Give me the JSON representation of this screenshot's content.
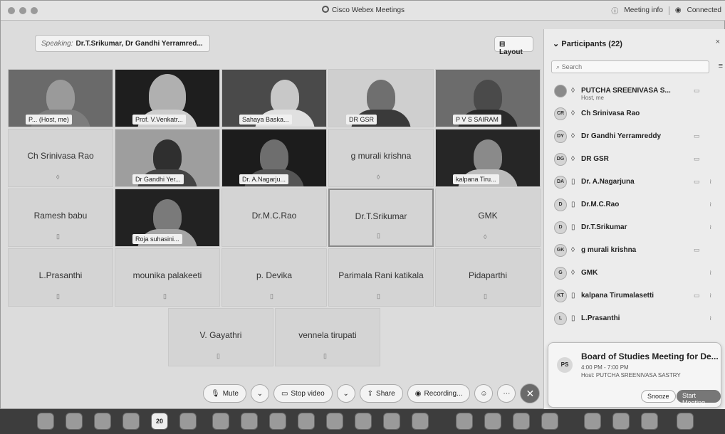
{
  "window": {
    "title": "Cisco Webex Meetings",
    "meeting_info": "Meeting info",
    "connection": "Connected"
  },
  "speaking": {
    "label": "Speaking:",
    "names": "Dr.T.Srikumar,  Dr Gandhi Yerramred..."
  },
  "layout_button": "Layout",
  "tiles": {
    "t1": "P...  (Host, me)",
    "t2": "Prof. V.Venkatr...",
    "t3": "Sahaya Baska...",
    "t4": "DR GSR",
    "t5": "P V S SAIRAM",
    "t6": "Ch Srinivasa Rao",
    "t7": "Dr Gandhi Yer...",
    "t8": "Dr. A.Nagarju...",
    "t9": "g murali krishna",
    "t10": "kalpana Tiru...",
    "t11": "Ramesh babu",
    "t12": "Roja suhasini...",
    "t13": "Dr.M.C.Rao",
    "t14": "Dr.T.Srikumar",
    "t15": "GMK",
    "t16": "L.Prasanthi",
    "t17": "mounika palakeeti",
    "t18": "p. Devika",
    "t19": "Parimala Rani katikala",
    "t20": "Pidaparthi",
    "t21": "V. Gayathri",
    "t22": "vennela tirupati"
  },
  "controls": {
    "mute": "Mute",
    "stop_video": "Stop video",
    "share": "Share",
    "recording": "Recording..."
  },
  "panel": {
    "title": "Participants (22)",
    "search_placeholder": "Search",
    "participants": [
      {
        "initials": "",
        "name": "PUTCHA SREENIVASA S...",
        "sub": "Host, me"
      },
      {
        "initials": "CR",
        "name": "Ch Srinivasa Rao"
      },
      {
        "initials": "DY",
        "name": "Dr Gandhi Yerramreddy"
      },
      {
        "initials": "DG",
        "name": "DR GSR"
      },
      {
        "initials": "DA",
        "name": "Dr. A.Nagarjuna"
      },
      {
        "initials": "D",
        "name": "Dr.M.C.Rao"
      },
      {
        "initials": "D",
        "name": "Dr.T.Srikumar"
      },
      {
        "initials": "GK",
        "name": "g murali krishna"
      },
      {
        "initials": "G",
        "name": "GMK"
      },
      {
        "initials": "KT",
        "name": "kalpana Tirumalasetti"
      },
      {
        "initials": "L",
        "name": "L.Prasanthi"
      }
    ]
  },
  "notification": {
    "initials": "PS",
    "title": "Board of Studies Meeting for De...",
    "time": "4:00 PM - 7:00 PM",
    "host": "Host: PUTCHA SREENIVASA SASTRY",
    "snooze": "Snooze",
    "start": "Start Meeting"
  },
  "dock": {
    "calendar_day": "20"
  }
}
